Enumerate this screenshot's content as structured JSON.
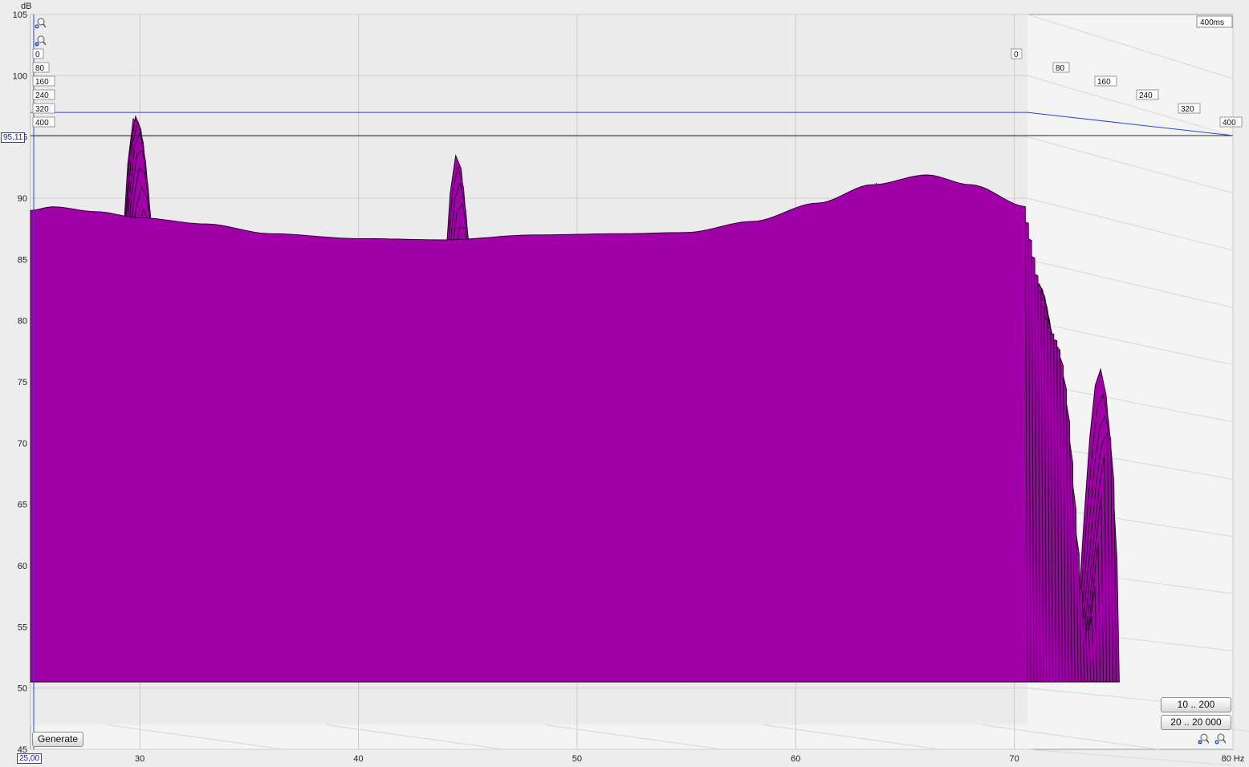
{
  "chart_data": {
    "type": "waterfall",
    "title": "",
    "xlabel": "Hz",
    "ylabel": "dB",
    "xlim": [
      25,
      80
    ],
    "ylim": [
      45,
      105
    ],
    "x_ticks": [
      30,
      40,
      50,
      60,
      70,
      80
    ],
    "x_tick_labels": [
      "30",
      "40",
      "50",
      "60",
      "70",
      "80 Hz"
    ],
    "y_ticks": [
      45,
      50,
      55,
      60,
      65,
      70,
      75,
      80,
      85,
      90,
      95,
      100,
      105
    ],
    "time_axis_label": "400ms",
    "time_ticks": [
      "0",
      "80",
      "160",
      "240",
      "320",
      "400"
    ],
    "cursor_level_db": "95,11",
    "cursor_freq_hz": "25,00",
    "fill_color": "#a000a8",
    "line_color": "#1a001c",
    "slice_count": 30,
    "front_profile": {
      "x": [
        25,
        26,
        28,
        30,
        33,
        36,
        40,
        44,
        48,
        52,
        55,
        58,
        61,
        63.5,
        66,
        68,
        70.6
      ],
      "y": [
        89.0,
        89.3,
        88.9,
        88.4,
        87.9,
        87.1,
        86.7,
        86.6,
        87.0,
        87.1,
        87.2,
        88.1,
        89.6,
        91.1,
        91.9,
        91.1,
        89.3
      ]
    }
  },
  "buttons": {
    "generate": "Generate",
    "range_low": "10 .. 200",
    "range_full": "20 .. 20 000"
  }
}
